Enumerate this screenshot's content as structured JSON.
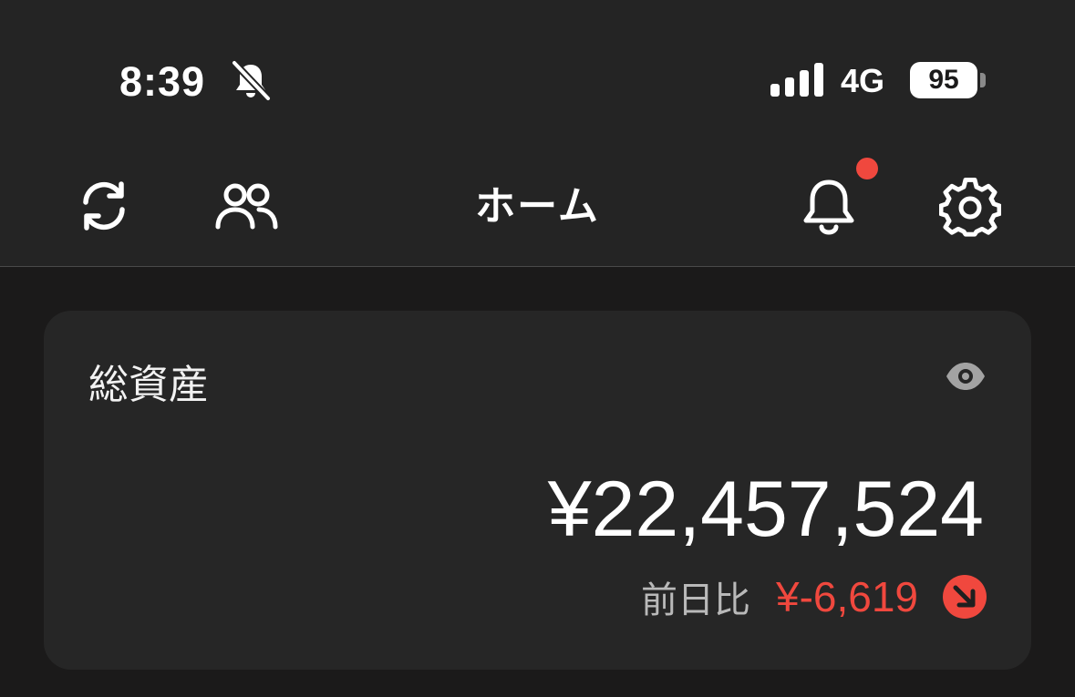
{
  "status_bar": {
    "time": "8:39",
    "network": "4G",
    "battery_percent": "95"
  },
  "header": {
    "title": "ホーム",
    "notification_badge_color": "#f0483e"
  },
  "asset_card": {
    "title": "総資産",
    "total_amount": "¥22,457,524",
    "change_label": "前日比",
    "change_value": "¥-6,619",
    "change_color": "#f0483e"
  },
  "icons": {
    "silent": "bell-slash-icon",
    "signal": "signal-bars-icon",
    "refresh": "refresh-icon",
    "people": "people-icon",
    "notifications": "bell-icon",
    "settings": "gear-icon",
    "visibility": "eye-icon",
    "trend": "arrow-down-right-icon"
  }
}
